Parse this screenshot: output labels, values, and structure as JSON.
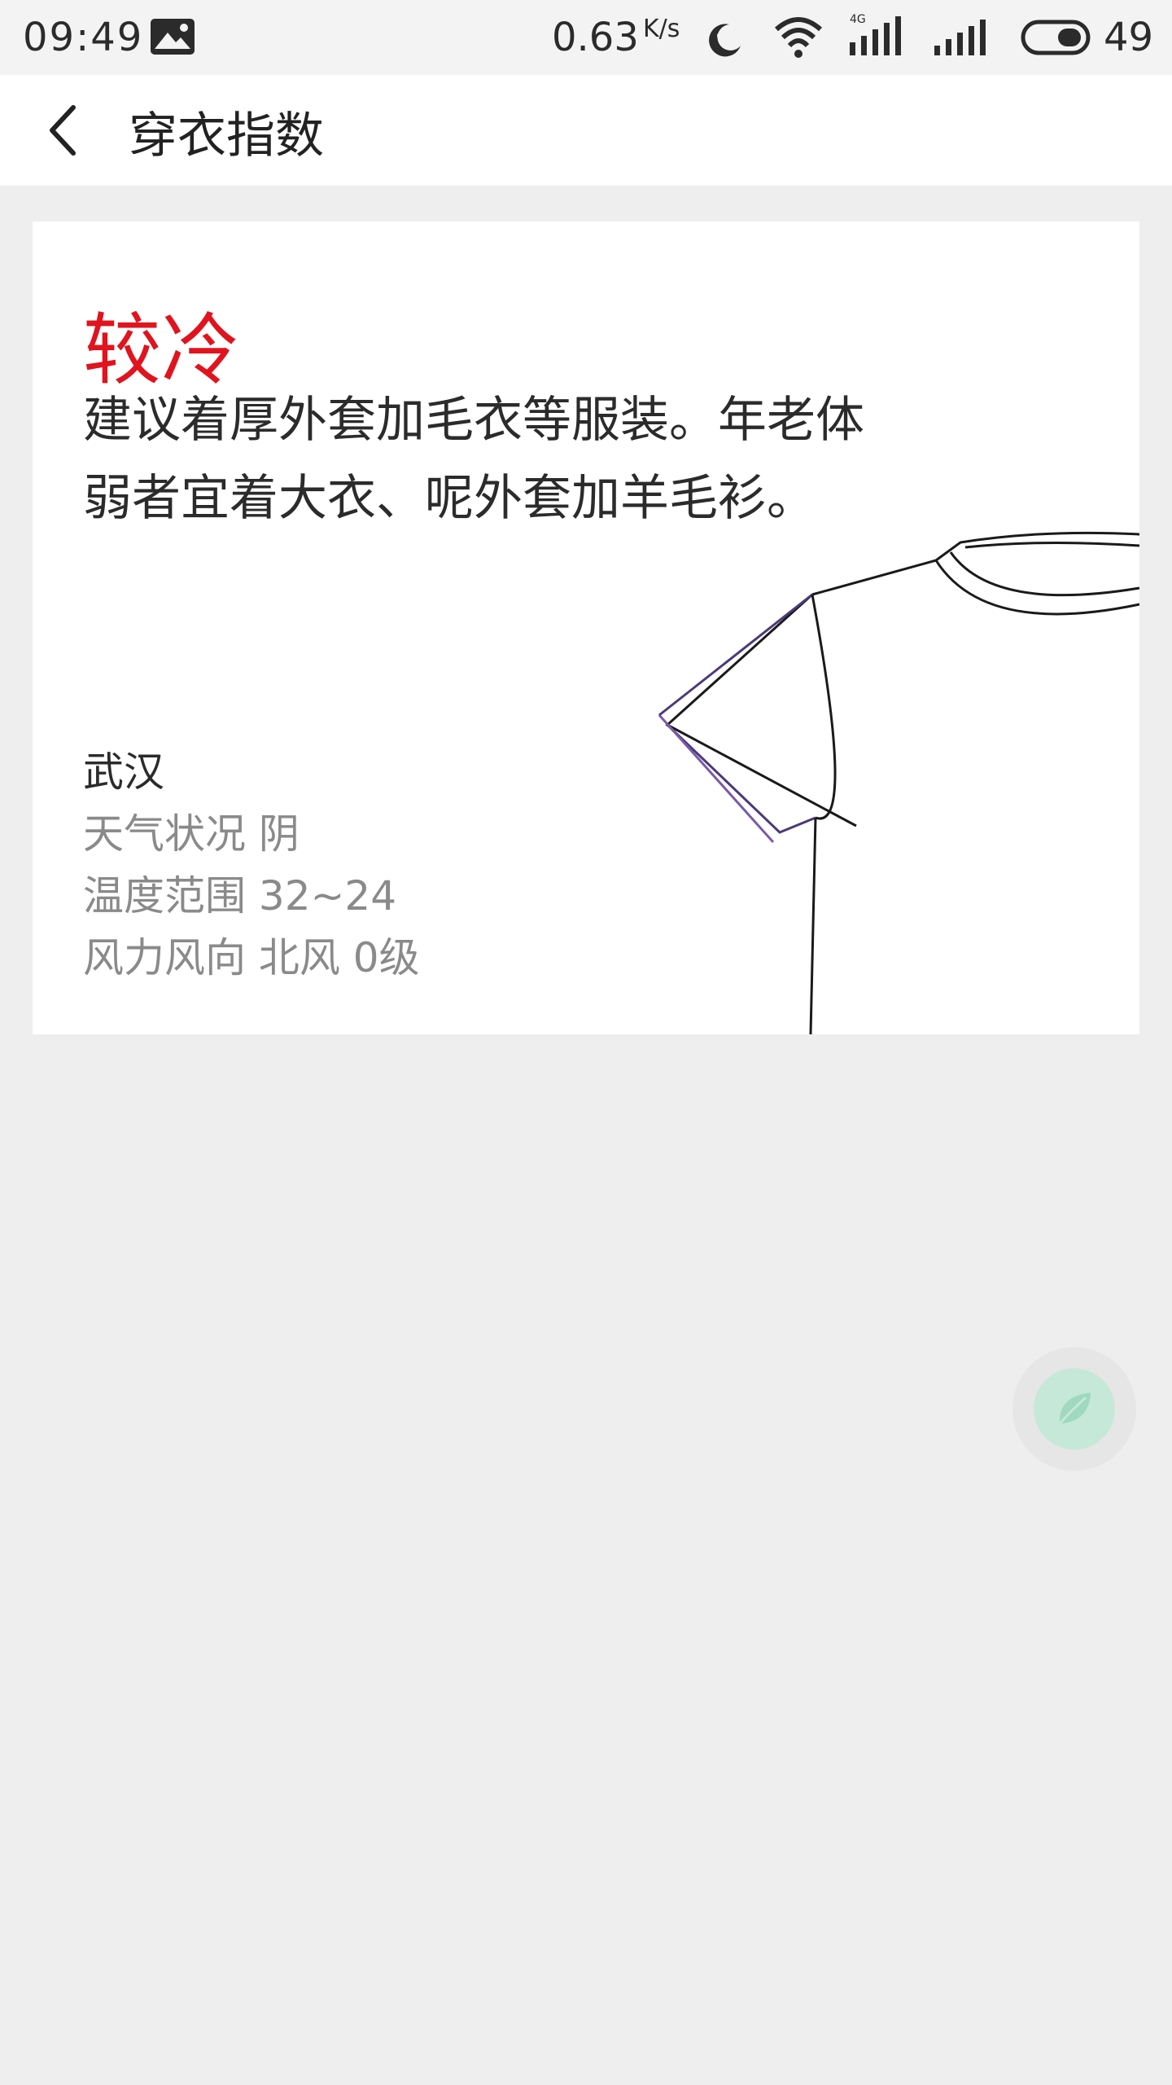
{
  "status_bar": {
    "time": "09:49",
    "net_speed": "0.63",
    "net_speed_unit": "K/s",
    "battery": "49",
    "network_type": "4G"
  },
  "header": {
    "title": "穿衣指数"
  },
  "card": {
    "level": "较冷",
    "advice": "建议着厚外套加毛衣等服装。年老体弱者宜着大衣、呢外套加羊毛衫。",
    "city": "武汉",
    "weather_label": "天气状况",
    "weather_value": "阴",
    "temp_label": "温度范围",
    "temp_value": "32~24",
    "wind_label": "风力风向",
    "wind_value": "北风 0级"
  },
  "colors": {
    "accent_red": "#e0141e",
    "fab_green": "#9fd9bf"
  },
  "icons": {
    "back": "chevron-left-icon",
    "fab": "leaf-icon"
  }
}
